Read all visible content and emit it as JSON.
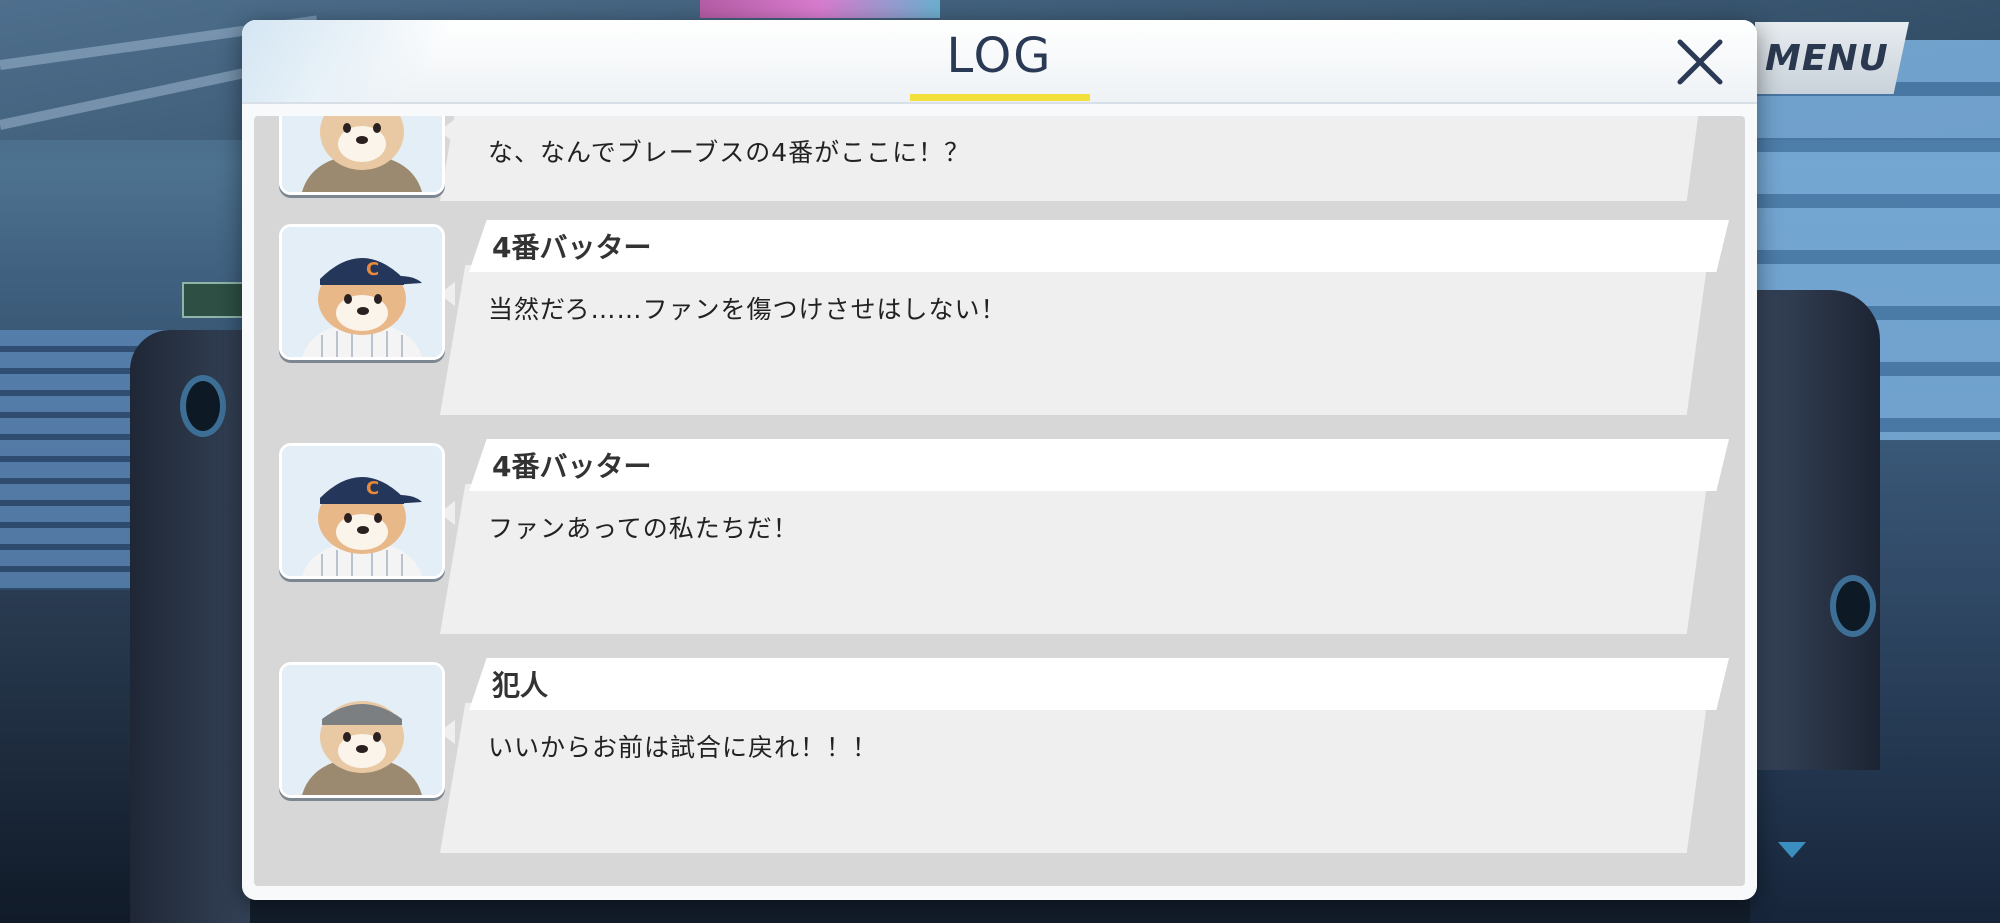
{
  "menu": {
    "label": "MENU"
  },
  "dialog": {
    "title": "LOG",
    "accent_color": "#f3e03a",
    "close_icon": "close-icon"
  },
  "log": {
    "entries": [
      {
        "speaker": "",
        "avatar": "culprit-dog-avatar",
        "text": "な、なんでブレーブスの4番がここに！？"
      },
      {
        "speaker": "4番バッター",
        "avatar": "batter-dog-avatar",
        "text": "当然だろ……ファンを傷つけさせはしない！"
      },
      {
        "speaker": "4番バッター",
        "avatar": "batter-dog-avatar",
        "text": "ファンあっての私たちだ！"
      },
      {
        "speaker": "犯人",
        "avatar": "culprit-dog-avatar",
        "text": "いいからお前は試合に戻れ！！！"
      }
    ]
  },
  "scroll": {
    "icon": "scroll-down-arrow-icon"
  }
}
